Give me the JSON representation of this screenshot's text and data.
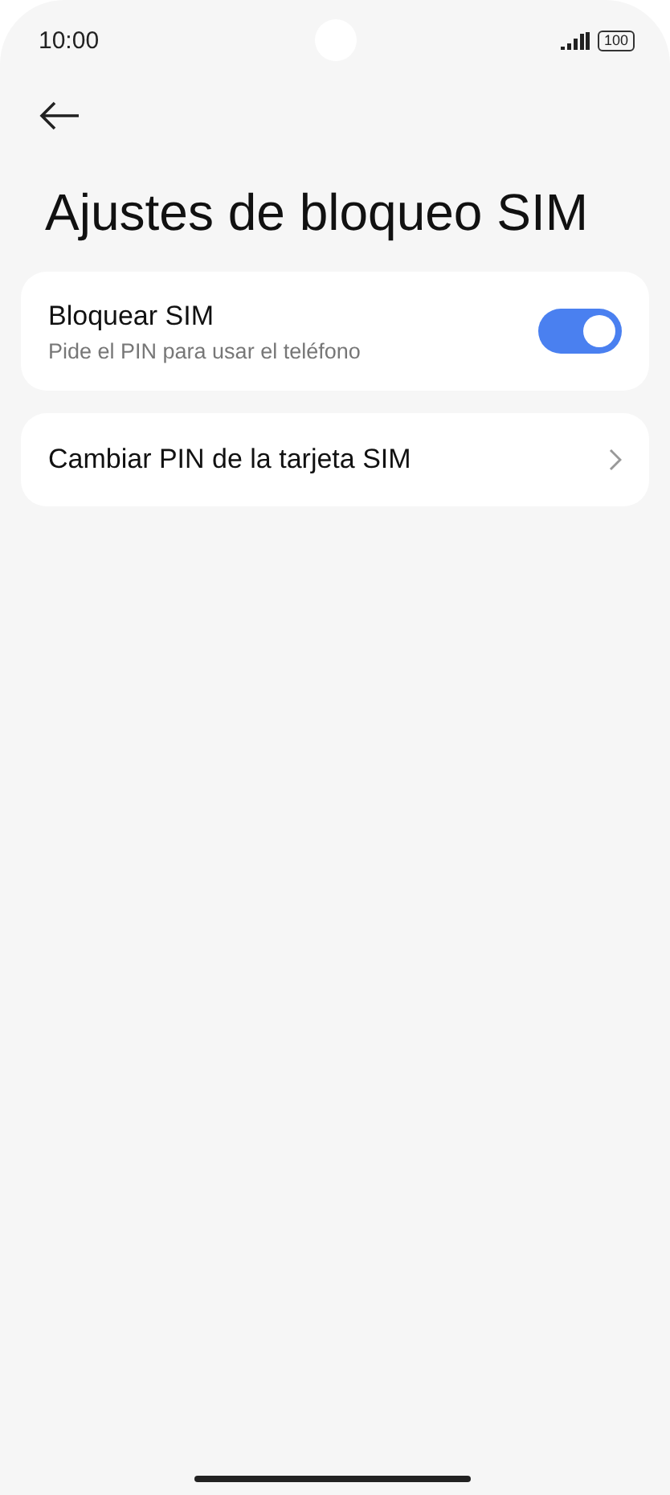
{
  "status_bar": {
    "time": "10:00",
    "battery": "100"
  },
  "title": "Ajustes de bloqueo SIM",
  "settings": [
    {
      "kind": "toggle",
      "label": "Bloquear SIM",
      "summary": "Pide el PIN para usar el teléfono",
      "on": true
    },
    {
      "kind": "link",
      "label": "Cambiar PIN de la tarjeta SIM"
    }
  ]
}
